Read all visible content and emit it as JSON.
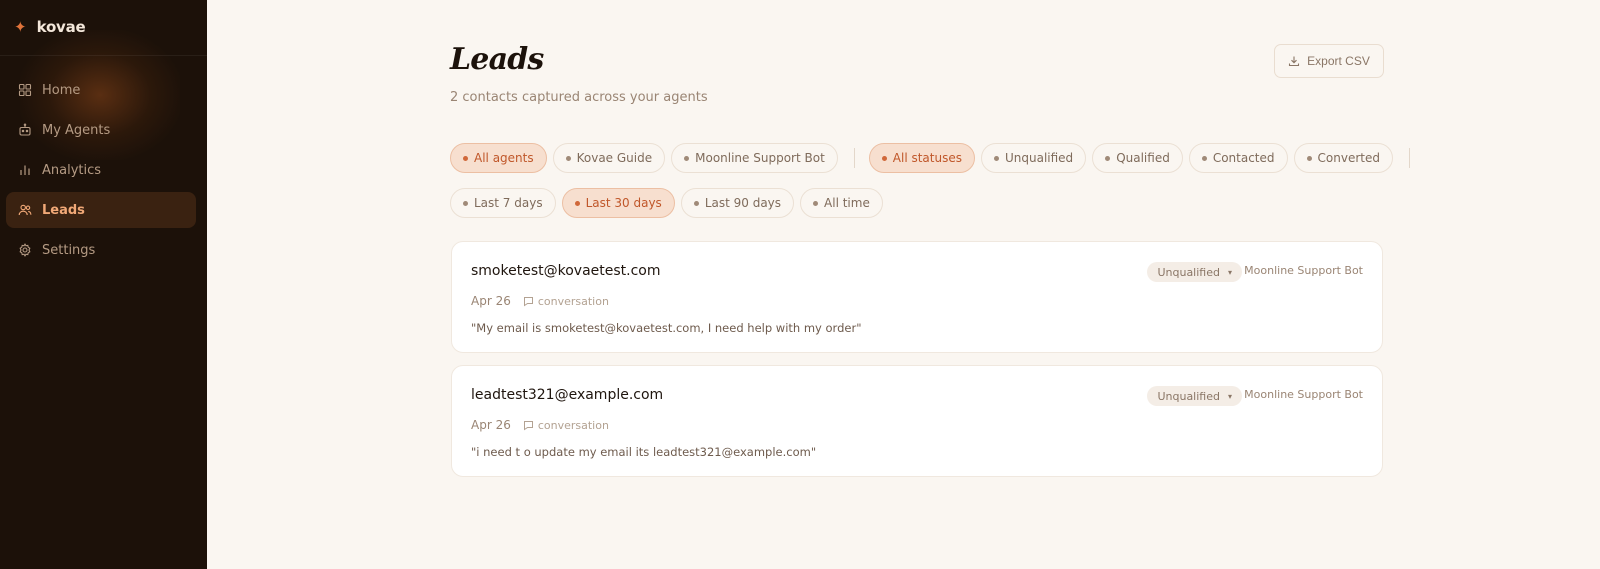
{
  "brand": {
    "name": "kovae",
    "mark": "✦"
  },
  "sidebar": {
    "items": [
      {
        "label": "Home",
        "icon": "home-grid-icon",
        "active": false
      },
      {
        "label": "My Agents",
        "icon": "bot-icon",
        "active": false
      },
      {
        "label": "Analytics",
        "icon": "bar-chart-icon",
        "active": false
      },
      {
        "label": "Leads",
        "icon": "users-icon",
        "active": true
      },
      {
        "label": "Settings",
        "icon": "gear-icon",
        "active": false
      }
    ]
  },
  "header": {
    "title": "Leads",
    "subtitle": "2 contacts captured across your agents",
    "export_label": "Export CSV"
  },
  "filters": {
    "agents": [
      {
        "label": "All agents",
        "active": true
      },
      {
        "label": "Kovae Guide",
        "active": false
      },
      {
        "label": "Moonline Support Bot",
        "active": false
      }
    ],
    "statuses": [
      {
        "label": "All statuses",
        "active": true
      },
      {
        "label": "Unqualified",
        "active": false
      },
      {
        "label": "Qualified",
        "active": false
      },
      {
        "label": "Contacted",
        "active": false
      },
      {
        "label": "Converted",
        "active": false
      }
    ],
    "ranges": [
      {
        "label": "Last 7 days",
        "active": false
      },
      {
        "label": "Last 30 days",
        "active": true
      },
      {
        "label": "Last 90 days",
        "active": false
      },
      {
        "label": "All time",
        "active": false
      }
    ]
  },
  "leads": [
    {
      "email": "smoketest@kovaetest.com",
      "date": "Apr 26",
      "source": "conversation",
      "quote": "\"My email is smoketest@kovaetest.com, I need help with my order\"",
      "status": "Unqualified",
      "agent": "Moonline Support Bot"
    },
    {
      "email": "leadtest321@example.com",
      "date": "Apr 26",
      "source": "conversation",
      "quote": "\"i need t o update my email its leadtest321@example.com\"",
      "status": "Unqualified",
      "agent": "Moonline Support Bot"
    }
  ],
  "colors": {
    "sidebar_bg": "#1c1109",
    "accent": "#d0683a",
    "active_chip_bg": "#f7dfcf",
    "page_bg": "#faf6f1"
  }
}
